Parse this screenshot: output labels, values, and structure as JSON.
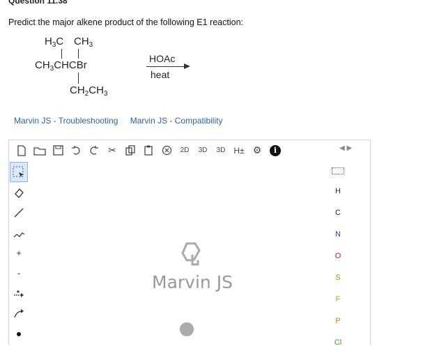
{
  "question": {
    "title": "Question 11.38",
    "prompt": "Predict the major alkene product of the following E1 reaction:"
  },
  "molecule": {
    "top_left": "H3C",
    "top_right": "CH3",
    "main_chain": "CH3CHCBr",
    "bottom": "CH2CH3"
  },
  "reaction": {
    "reagent": "HOAc",
    "condition": "heat"
  },
  "links": {
    "troubleshooting": "Marvin JS - Troubleshooting",
    "compatibility": "Marvin JS - Compatibility"
  },
  "editor": {
    "brand": "Marvin JS",
    "toolbar": {
      "clean2d": "2D",
      "clean3d": "3D",
      "view3d": "3D",
      "hydrogens": "H±"
    },
    "left_tools": {
      "charge_plus": "+",
      "charge_minus": "-"
    },
    "atoms": [
      "H",
      "C",
      "N",
      "O",
      "S",
      "F",
      "P",
      "Cl"
    ],
    "atom_colors": {
      "H": "#222222",
      "C": "#222222",
      "N": "#2b35d6",
      "O": "#e01414",
      "S": "#b28a00",
      "F": "#8ab800",
      "P": "#e08000",
      "Cl": "#2ca02c"
    },
    "nav": "◀ ▶"
  }
}
